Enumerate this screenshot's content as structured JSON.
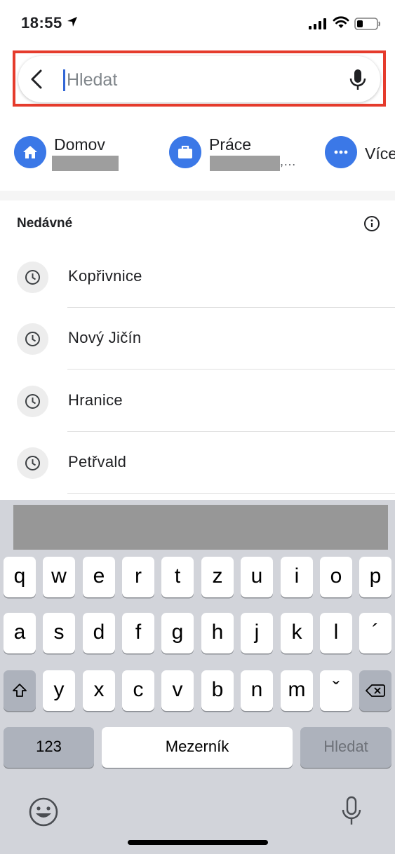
{
  "status_bar": {
    "time": "18:55",
    "icons": [
      "location-arrow-icon",
      "cellular-signal-icon",
      "wifi-icon",
      "battery-icon"
    ]
  },
  "search": {
    "placeholder": "Hledat",
    "back_icon": "chevron-left-icon",
    "mic_icon": "microphone-icon",
    "highlight_color": "#e53b2c"
  },
  "shortcuts": [
    {
      "label": "Domov",
      "icon": "home-icon"
    },
    {
      "label": "Práce",
      "sub": ",…",
      "icon": "briefcase-icon"
    },
    {
      "label": "Více",
      "icon": "more-horizontal-icon"
    }
  ],
  "accent_color": "#3b78e7",
  "recent": {
    "title": "Nedávné",
    "info_icon": "info-icon",
    "items": [
      {
        "label": "Kopřivnice",
        "icon": "history-clock-icon"
      },
      {
        "label": "Nový Jičín",
        "icon": "history-clock-icon"
      },
      {
        "label": "Hranice",
        "icon": "history-clock-icon"
      },
      {
        "label": "Petřvald",
        "icon": "history-clock-icon"
      }
    ]
  },
  "keyboard": {
    "row1": [
      "q",
      "w",
      "e",
      "r",
      "t",
      "z",
      "u",
      "i",
      "o",
      "p"
    ],
    "row2": [
      "a",
      "s",
      "d",
      "f",
      "g",
      "h",
      "j",
      "k",
      "l",
      "´"
    ],
    "row3": [
      "y",
      "x",
      "c",
      "v",
      "b",
      "n",
      "m",
      "ˇ"
    ],
    "shift_icon": "shift-icon",
    "backspace_icon": "backspace-icon",
    "numbers_label": "123",
    "space_label": "Mezerník",
    "return_label": "Hledat",
    "emoji_icon": "emoji-icon",
    "dictation_icon": "microphone-icon"
  }
}
